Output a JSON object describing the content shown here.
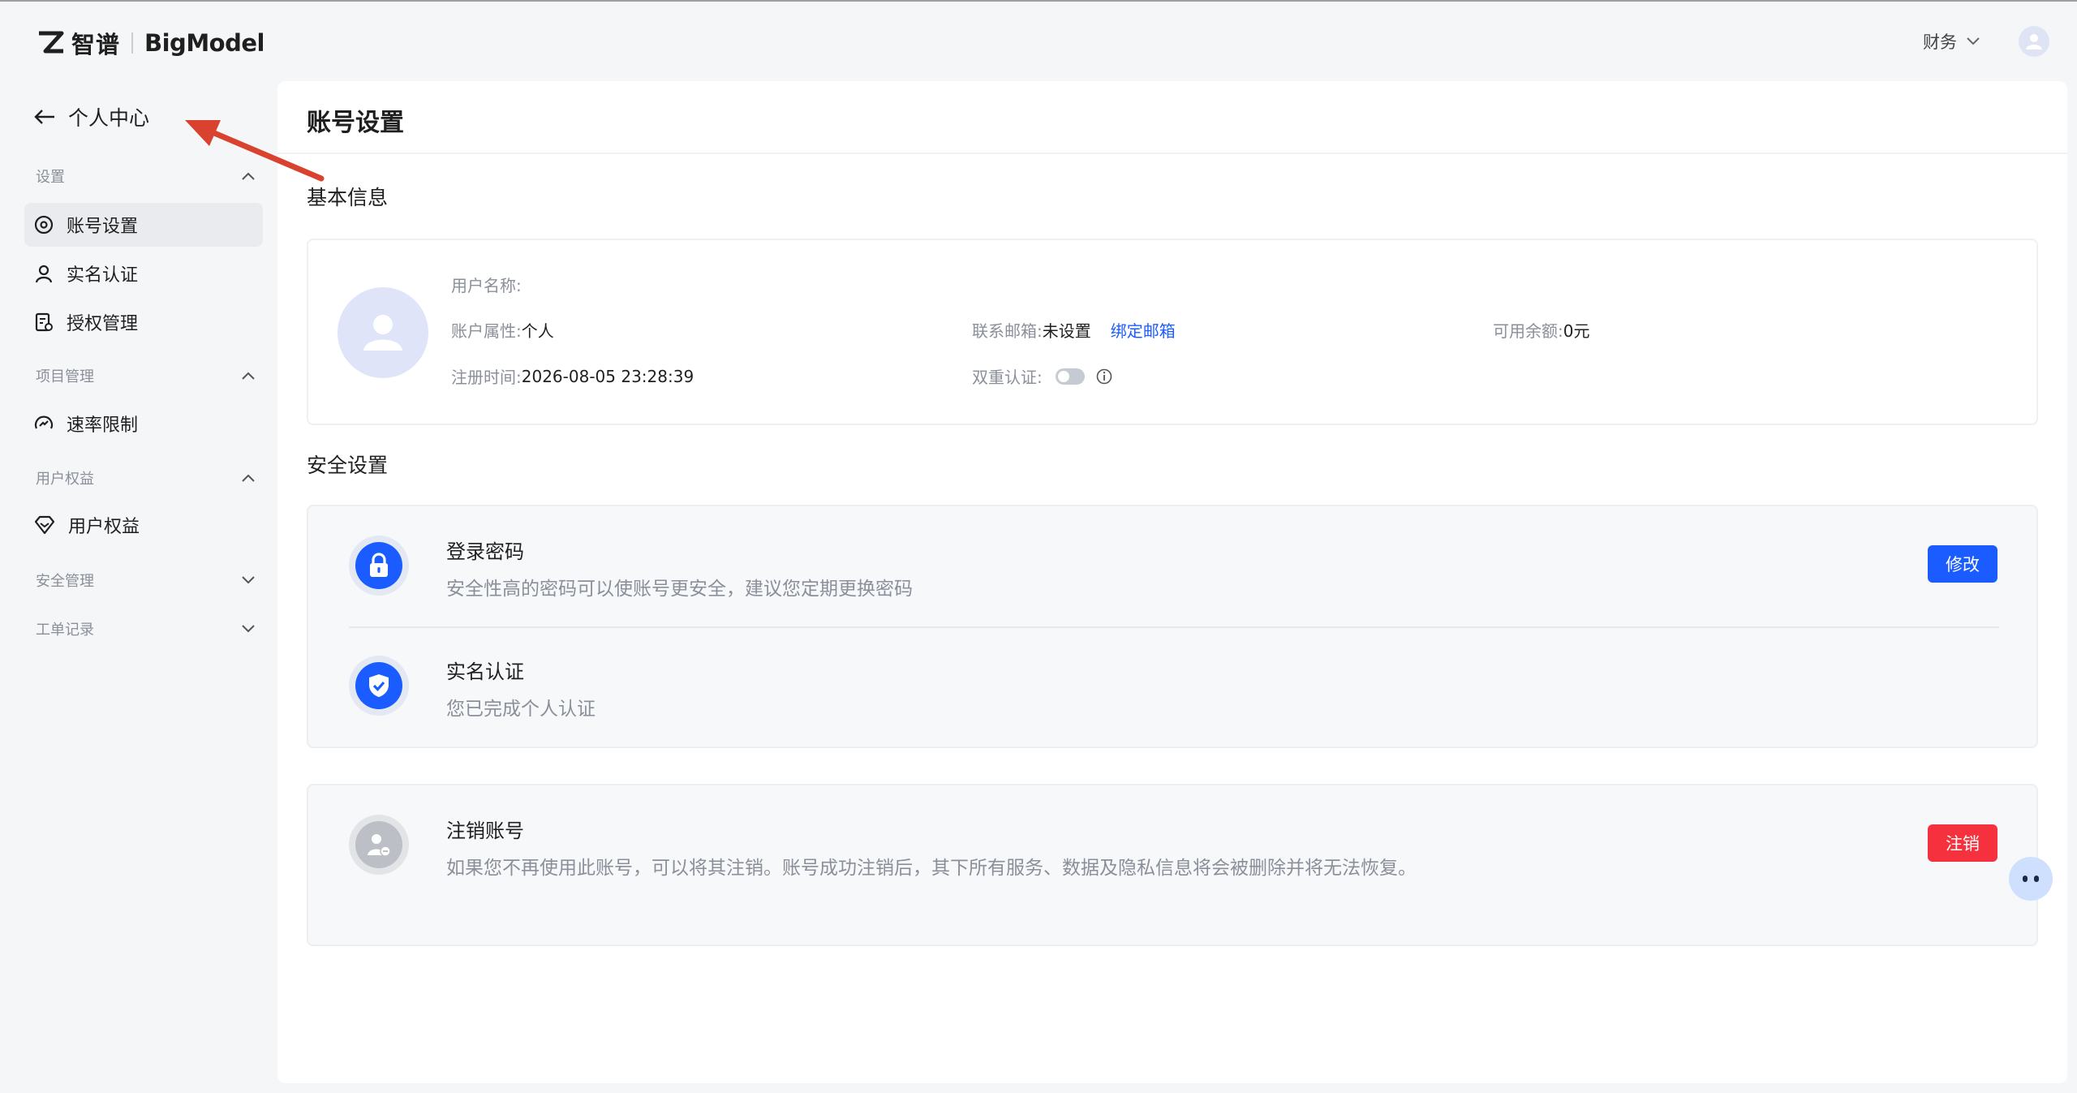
{
  "brand": {
    "cn": "智谱",
    "en": "BigModel"
  },
  "header": {
    "finance_label": "财务",
    "icons": [
      "chevron-down-icon",
      "user-avatar-icon"
    ]
  },
  "sidebar": {
    "back_label": "个人中心",
    "groups": [
      {
        "label": "设置",
        "expanded": true,
        "items": [
          {
            "label": "账号设置",
            "icon": "settings-circle-icon",
            "active": true
          },
          {
            "label": "实名认证",
            "icon": "person-icon"
          },
          {
            "label": "授权管理",
            "icon": "document-auth-icon"
          }
        ]
      },
      {
        "label": "项目管理",
        "expanded": true,
        "items": [
          {
            "label": "速率限制",
            "icon": "gauge-icon"
          }
        ]
      },
      {
        "label": "用户权益",
        "expanded": true,
        "items": [
          {
            "label": "用户权益",
            "icon": "diamond-icon"
          }
        ]
      },
      {
        "label": "安全管理",
        "expanded": false,
        "items": []
      },
      {
        "label": "工单记录",
        "expanded": false,
        "items": []
      }
    ]
  },
  "main": {
    "title": "账号设置",
    "basic_title": "基本信息",
    "basic": {
      "username_label": "用户名称:",
      "username_value": "",
      "account_type_label": "账户属性:",
      "account_type_value": "个人",
      "register_time_label": "注册时间:",
      "register_time_value": "2026-08-05 23:28:39",
      "email_label": "联系邮箱:",
      "email_value": "未设置",
      "bind_email_link": "绑定邮箱",
      "two_factor_label": "双重认证:",
      "two_factor_enabled": false,
      "balance_label": "可用余额:",
      "balance_value": "0元"
    },
    "security_title": "安全设置",
    "security": [
      {
        "title": "登录密码",
        "desc": "安全性高的密码可以使账号更安全，建议您定期更换密码",
        "button": "修改",
        "icon": "lock-icon"
      },
      {
        "title": "实名认证",
        "desc": "您已完成个人认证",
        "icon": "shield-check-icon"
      }
    ],
    "cancel": {
      "title": "注销账号",
      "desc": "如果您不再使用此账号，可以将其注销。账号成功注销后，其下所有服务、数据及隐私信息将会被删除并将无法恢复。",
      "button": "注销",
      "icon": "user-remove-icon"
    }
  },
  "colors": {
    "primary": "#1a5cff",
    "danger": "#f5313d",
    "annotation_arrow": "#d9422f"
  }
}
